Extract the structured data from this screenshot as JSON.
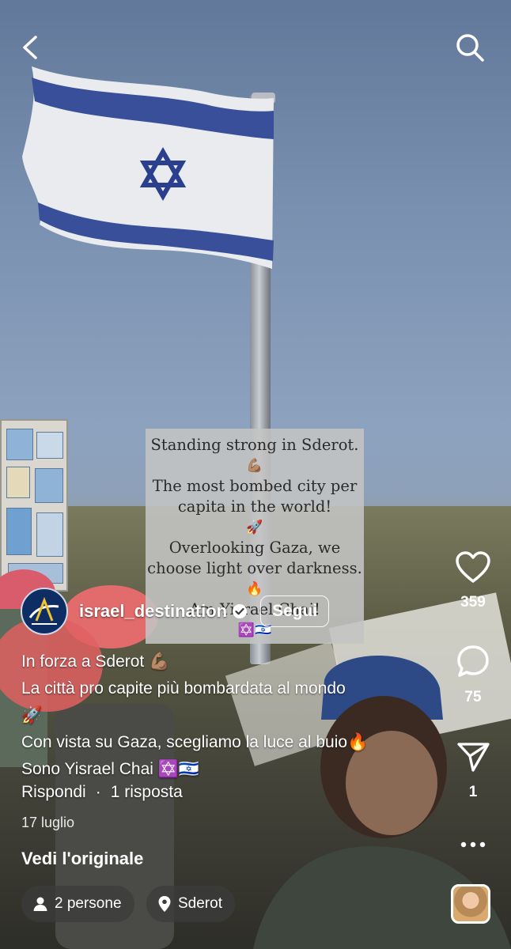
{
  "header": {
    "back_icon": "back-arrow-icon",
    "search_icon": "search-icon"
  },
  "post_image": {
    "overlay_text": [
      "Standing strong in Sderot.",
      "💪🏽",
      "The most bombed city per",
      "capita in the world!",
      "🚀",
      "Overlooking Gaza, we",
      "choose light over darkness.",
      "🔥",
      "Am Yisrael Chai!",
      "✡️🇮🇱"
    ]
  },
  "actions": {
    "like_count": "359",
    "comment_count": "75",
    "share_count": "1"
  },
  "author": {
    "username": "israel_destination",
    "verified": true,
    "follow_label": "Segui"
  },
  "caption": {
    "lines": [
      "In forza a Sderot 💪🏽",
      "La città pro capite più bombardata al mondo",
      "🚀",
      "Con vista su Gaza, scegliamo la luce al buio🔥",
      "Sono Yisrael Chai ✡️🇮🇱"
    ]
  },
  "meta": {
    "reply_label": "Rispondi",
    "separator": "·",
    "replies_label": "1 risposta",
    "date": "17 luglio"
  },
  "see_original_label": "Vedi l'originale",
  "chips": {
    "people_label": "2 persone",
    "location_label": "Sderot"
  },
  "colors": {
    "flag_blue": "#2b3f8f",
    "text_white": "#ffffff",
    "chip_bg": "#3c3c3c"
  }
}
